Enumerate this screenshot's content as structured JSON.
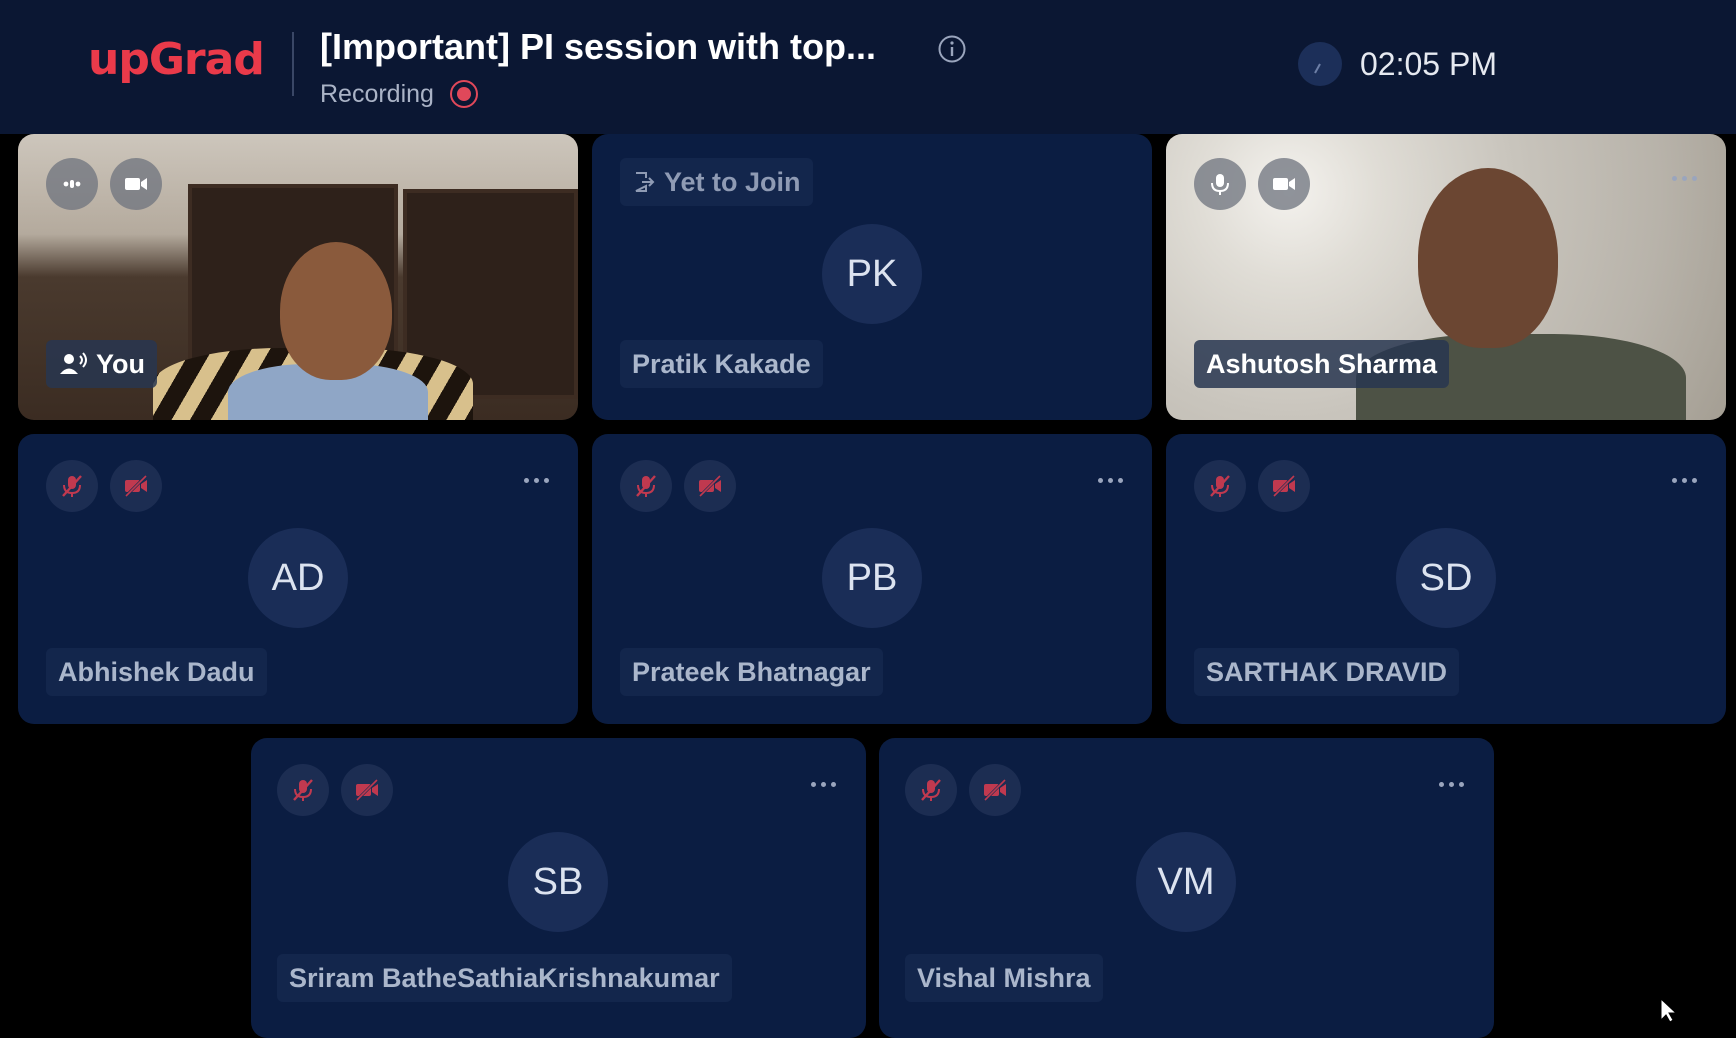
{
  "header": {
    "logo": "upGrad",
    "title": "[Important] PI session with top...",
    "recording_label": "Recording",
    "time": "02:05 PM"
  },
  "participants": [
    {
      "name": "You",
      "video": true
    },
    {
      "name": "Pratik Kakade",
      "initials": "PK",
      "status": "Yet to Join"
    },
    {
      "name": "Ashutosh Sharma",
      "video": true
    },
    {
      "name": "Abhishek Dadu",
      "initials": "AD"
    },
    {
      "name": "Prateek Bhatnagar",
      "initials": "PB"
    },
    {
      "name": "SARTHAK DRAVID",
      "initials": "SD"
    },
    {
      "name": "Sriram BatheSathiaKrishnakumar",
      "initials": "SB"
    },
    {
      "name": "Vishal Mishra",
      "initials": "VM"
    }
  ],
  "colors": {
    "brand": "#ea3a4a",
    "header_bg": "#0b1733",
    "tile_bg": "#0b1d42",
    "muted_icon": "#c0394f",
    "recording": "#e0485a"
  }
}
